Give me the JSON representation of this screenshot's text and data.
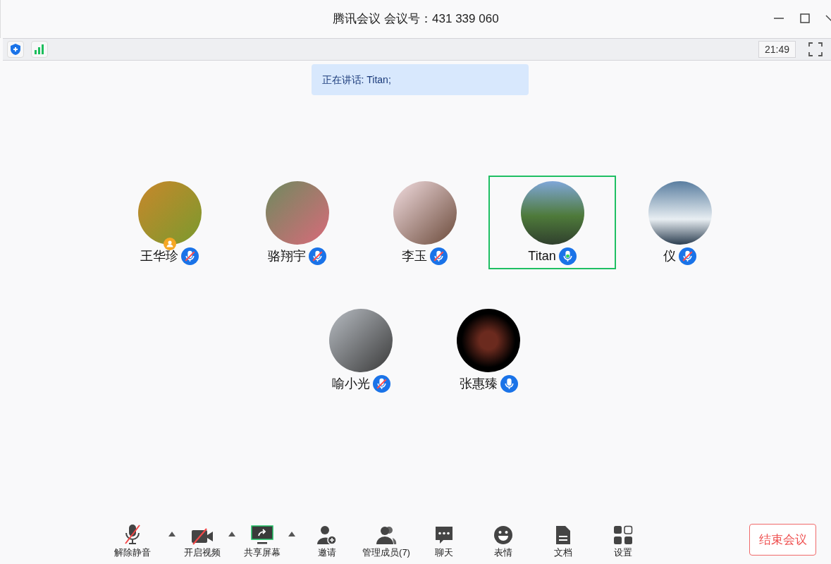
{
  "window": {
    "title": "腾讯会议 会议号：431 339 060"
  },
  "info_bar": {
    "time": "21:49"
  },
  "speaking_banner": "正在讲话: Titan;",
  "participants": [
    {
      "name": "王华珍",
      "muted": true,
      "speaking": false,
      "host": true,
      "selected": false
    },
    {
      "name": "骆翔宇",
      "muted": true,
      "speaking": false,
      "host": false,
      "selected": false
    },
    {
      "name": "李玉",
      "muted": true,
      "speaking": false,
      "host": false,
      "selected": false
    },
    {
      "name": "Titan",
      "muted": false,
      "speaking": true,
      "host": false,
      "selected": true
    },
    {
      "name": "仪",
      "muted": true,
      "speaking": false,
      "host": false,
      "selected": false
    },
    {
      "name": "喻小光",
      "muted": true,
      "speaking": false,
      "host": false,
      "selected": false
    },
    {
      "name": "张惠臻",
      "muted": false,
      "speaking": false,
      "host": false,
      "selected": false
    }
  ],
  "toolbar": [
    {
      "kind": "mic",
      "label": "解除静音",
      "off": true,
      "menu": true
    },
    {
      "kind": "video",
      "label": "开启视频",
      "off": true,
      "menu": true
    },
    {
      "kind": "share",
      "label": "共享屏幕",
      "menu": true
    },
    {
      "kind": "invite",
      "label": "邀请",
      "menu": false
    },
    {
      "kind": "members",
      "label": "管理成员(7)",
      "menu": false
    },
    {
      "kind": "chat",
      "label": "聊天",
      "menu": false
    },
    {
      "kind": "emoji",
      "label": "表情",
      "menu": false
    },
    {
      "kind": "doc",
      "label": "文档",
      "menu": false
    },
    {
      "kind": "settings",
      "label": "设置",
      "menu": false
    }
  ],
  "end_button": "结束会议"
}
